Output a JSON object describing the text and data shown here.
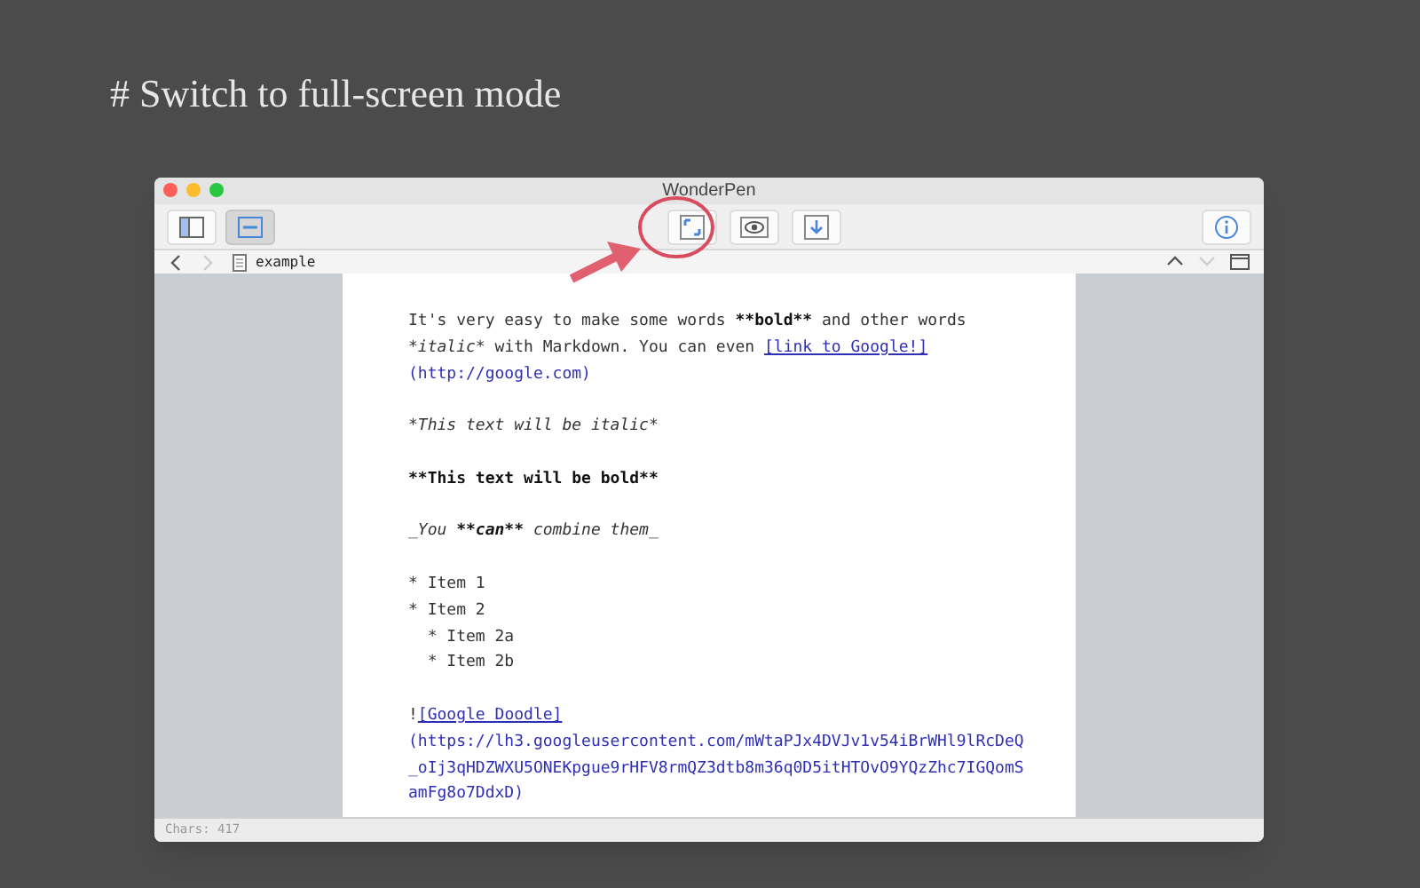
{
  "heading": "# Switch to full-screen mode",
  "window": {
    "title": "WonderPen"
  },
  "toolbar": {
    "left": [
      {
        "kind": "sidebar",
        "selected": false
      },
      {
        "kind": "toolbar",
        "selected": true
      }
    ],
    "center": [
      {
        "kind": "fullscreen",
        "selected": false
      },
      {
        "kind": "preview",
        "selected": false
      },
      {
        "kind": "export",
        "selected": false
      }
    ],
    "right": [
      {
        "kind": "info",
        "selected": false
      }
    ]
  },
  "pathbar": {
    "back_disabled": false,
    "forward_disabled": true,
    "document": "example",
    "up_disabled": false,
    "down_disabled": true
  },
  "editor": {
    "lines": [
      {
        "kind": "text",
        "segments": [
          {
            "kind": "plain",
            "text": "It's very easy to make some words "
          },
          {
            "kind": "bold",
            "text": "**bold**"
          },
          {
            "kind": "plain",
            "text": " and other words"
          }
        ]
      },
      {
        "kind": "text",
        "segments": [
          {
            "kind": "italic",
            "text": "*italic*"
          },
          {
            "kind": "plain",
            "text": " with Markdown. You can even "
          },
          {
            "kind": "link",
            "text": "[link to Google!]"
          }
        ]
      },
      {
        "kind": "text",
        "segments": [
          {
            "kind": "url",
            "text": "(http://google.com)"
          }
        ]
      },
      {
        "kind": "blank"
      },
      {
        "kind": "text",
        "segments": [
          {
            "kind": "italic",
            "text": "*This text will be italic*"
          }
        ]
      },
      {
        "kind": "blank"
      },
      {
        "kind": "text",
        "segments": [
          {
            "kind": "bold",
            "text": "**This text will be bold**"
          }
        ]
      },
      {
        "kind": "blank"
      },
      {
        "kind": "text",
        "segments": [
          {
            "kind": "italic",
            "text": "_You "
          },
          {
            "kind": "bolditalic",
            "text": "**can**"
          },
          {
            "kind": "italic",
            "text": " combine them_"
          }
        ]
      },
      {
        "kind": "blank"
      },
      {
        "kind": "text",
        "segments": [
          {
            "kind": "plain",
            "text": "* Item 1"
          }
        ]
      },
      {
        "kind": "text",
        "segments": [
          {
            "kind": "plain",
            "text": "* Item 2"
          }
        ]
      },
      {
        "kind": "text",
        "segments": [
          {
            "kind": "plain",
            "text": "  * Item 2a"
          }
        ]
      },
      {
        "kind": "text",
        "segments": [
          {
            "kind": "plain",
            "text": "  * Item 2b"
          }
        ]
      },
      {
        "kind": "blank"
      },
      {
        "kind": "text",
        "segments": [
          {
            "kind": "plain",
            "text": "!"
          },
          {
            "kind": "link",
            "text": "[Google Doodle]"
          }
        ]
      },
      {
        "kind": "text",
        "segments": [
          {
            "kind": "url",
            "text": "(https://lh3.googleusercontent.com/mWtaPJx4DVJv1v54iBrWHl9lRcDeQ"
          }
        ]
      },
      {
        "kind": "text",
        "segments": [
          {
            "kind": "url",
            "text": "_oIj3qHDZWXU5ONEKpgue9rHFV8rmQZ3dtb8m36q0D5itHTOvO9YQzZhc7IGQomS"
          }
        ]
      },
      {
        "kind": "text",
        "segments": [
          {
            "kind": "url",
            "text": "amFg8o7DdxD)"
          }
        ]
      }
    ]
  },
  "status_bar": {
    "text": "Chars: 417"
  }
}
